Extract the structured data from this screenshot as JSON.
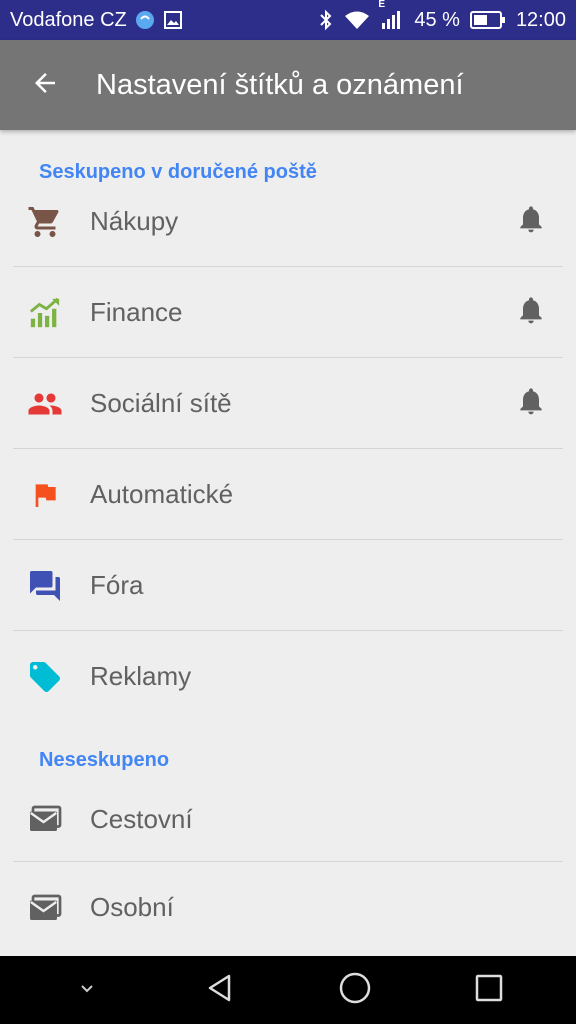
{
  "status_bar": {
    "carrier": "Vodafone CZ",
    "network_type": "E",
    "battery_percent": "45 %",
    "time": "12:00"
  },
  "app_bar": {
    "title": "Nastavení štítků a oznámení"
  },
  "sections": [
    {
      "header": "Seskupeno v doručené poště",
      "items": [
        {
          "label": "Nákupy",
          "icon": "shopping-cart-icon",
          "color": "#795548",
          "bell": true
        },
        {
          "label": "Finance",
          "icon": "trending-up-icon",
          "color": "#7cb342",
          "bell": true
        },
        {
          "label": "Sociální sítě",
          "icon": "people-icon",
          "color": "#e53935",
          "bell": true
        },
        {
          "label": "Automatické",
          "icon": "flag-icon",
          "color": "#f4511e",
          "bell": false
        },
        {
          "label": "Fóra",
          "icon": "forum-icon",
          "color": "#3f51b5",
          "bell": false
        },
        {
          "label": "Reklamy",
          "icon": "tag-icon",
          "color": "#00bcd4",
          "bell": false
        }
      ]
    },
    {
      "header": "Neseskupeno",
      "items": [
        {
          "label": "Cestovní",
          "icon": "mail-icon",
          "color": "#616161",
          "bell": false
        },
        {
          "label": "Osobní",
          "icon": "mail-icon",
          "color": "#616161",
          "bell": false
        }
      ]
    }
  ],
  "colors": {
    "status_bar": "#2d2d8a",
    "app_bar": "#757575",
    "section_header": "#4285f4",
    "bell": "#616161"
  }
}
